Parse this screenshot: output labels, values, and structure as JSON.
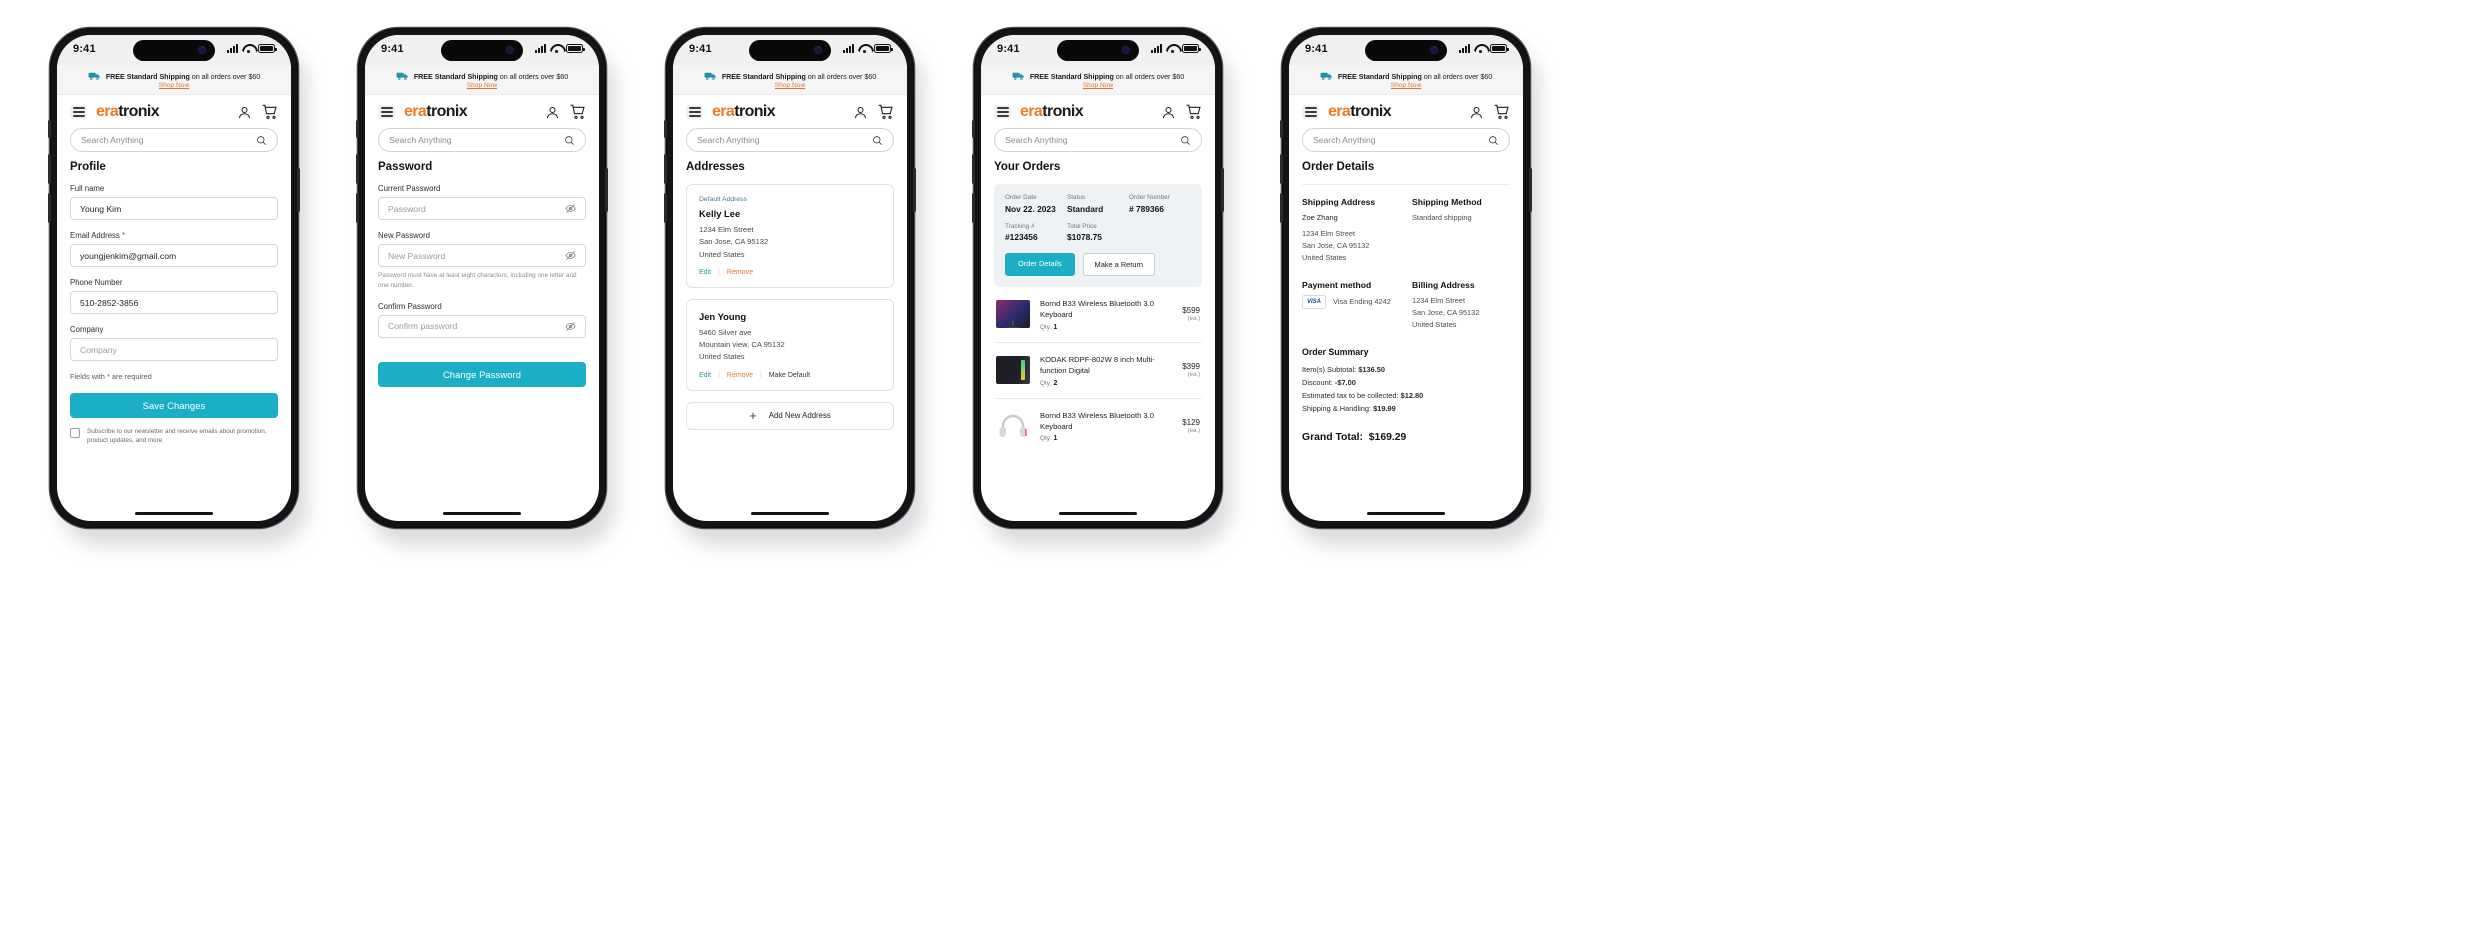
{
  "colors": {
    "accent": "#1aafc4",
    "brand_orange": "#f07c1f",
    "link_orange": "#e8742c",
    "required_red": "#d32a3a",
    "teal_link": "#2f93a8"
  },
  "status_bar": {
    "time": "9:41"
  },
  "promo": {
    "icon": "truck-icon",
    "bold_part": "FREE Standard Shipping",
    "rest_part": " on all orders over $60",
    "link": "Shop Now"
  },
  "nav": {
    "menu_icon": "hamburger-menu-icon",
    "brand_first": "era",
    "brand_second": "tronix",
    "account_icon": "user-account-icon",
    "cart_icon": "shopping-cart-icon"
  },
  "search": {
    "placeholder": "Search Anything",
    "icon": "search-icon"
  },
  "screens": [
    {
      "id": "profile",
      "title": "Profile",
      "fields": [
        {
          "label": "Full name",
          "required": false,
          "value": "Young Kim",
          "is_placeholder": false
        },
        {
          "label": "Email Address",
          "required": true,
          "value": "youngjenkim@gmail.com",
          "is_placeholder": false
        },
        {
          "label": "Phone Number",
          "required": false,
          "value": "510-2852-3856",
          "is_placeholder": false
        },
        {
          "label": "Company",
          "required": false,
          "value": "Company",
          "is_placeholder": true
        }
      ],
      "note_prefix": "Fields with ",
      "note_suffix": " are required",
      "submit": "Save Changes",
      "subscribe_text": "Subscribe to our newsletter and receive emails about promotion, product updates, and more"
    },
    {
      "id": "password",
      "title": "Password",
      "fields": [
        {
          "label": "Current Password",
          "value": "Password",
          "is_placeholder": true,
          "has_eye": true
        },
        {
          "label": "New Password",
          "value": "New Password",
          "is_placeholder": true,
          "has_eye": true
        },
        {
          "label": "Confirm Password",
          "value": "Confirm password",
          "is_placeholder": true,
          "has_eye": true
        }
      ],
      "hint": "Password must have at least eight characters, including one letter and one number.",
      "submit": "Change Password"
    },
    {
      "id": "addresses",
      "title": "Addresses",
      "cards": [
        {
          "tag": "Default Address",
          "name": "Kelly Lee",
          "lines": [
            "1234 Elm Street",
            "San Jose, CA 95132",
            "United States"
          ],
          "actions": [
            "Edit",
            "Remove"
          ]
        },
        {
          "tag": "",
          "name": "Jen Young",
          "lines": [
            "5460 Silver ave",
            "Mountain view, CA 95132",
            "United States"
          ],
          "actions": [
            "Edit",
            "Remove",
            "Make Default"
          ]
        }
      ],
      "add_new": "Add New Address",
      "add_icon": "plus-icon"
    },
    {
      "id": "orders",
      "title": "Your Orders",
      "summary": {
        "order_date_label": "Order Date",
        "order_date_value": "Nov 22. 2023",
        "status_label": "Status",
        "status_value": "Standard",
        "order_number_label": "Order Number",
        "order_number_value": "# 789366",
        "tracking_label": "Tracking #",
        "tracking_value": "#123456",
        "total_label": "Total Price",
        "total_value": "$1078.75",
        "primary_button": "Order Details",
        "secondary_button": "Make a Return"
      },
      "products": [
        {
          "name": "Bornd B33 Wireless Bluetooth 3.0 Keyboard",
          "qty_label": "Qty:",
          "qty": "1",
          "price": "$599",
          "unit": "(ea.)",
          "thumb": "monitor-thumbnail"
        },
        {
          "name": "KODAK RDPF-802W 8 inch Multi-function Digital",
          "qty_label": "Qty:",
          "qty": "2",
          "price": "$399",
          "unit": "(ea.)",
          "thumb": "pc-tower-thumbnail"
        },
        {
          "name": "Bornd B33 Wireless Bluetooth 3.0 Keyboard",
          "qty_label": "Qty:",
          "qty": "1",
          "price": "$129",
          "unit": "(ea.)",
          "thumb": "headset-thumbnail"
        }
      ]
    },
    {
      "id": "order-details",
      "title": "Order Details",
      "shipping_address": {
        "heading": "Shipping Address",
        "name": "Zoe Zhang",
        "lines": [
          "1234 Elm Street",
          "San Jose, CA 95132",
          "United States"
        ]
      },
      "shipping_method": {
        "heading": "Shipping Method",
        "value": "Standard shipping"
      },
      "payment_method": {
        "heading": "Payment method",
        "card_brand": "VISA",
        "card_text": "Visa Ending 4242"
      },
      "billing_address": {
        "heading": "Billing Address",
        "lines": [
          "1234 Elm Street",
          "San Jose, CA 95132",
          "United States"
        ]
      },
      "order_summary": {
        "heading": "Order Summary",
        "rows": [
          {
            "label": "Item(s) Subtotal:",
            "value": "$136.50"
          },
          {
            "label": "Discount:",
            "value": "-$7.00"
          },
          {
            "label": "Estimated tax to be collected:",
            "value": "$12.80"
          },
          {
            "label": "Shipping & Handling:",
            "value": "$19.99"
          }
        ],
        "grand_label": "Grand Total:",
        "grand_value": "$169.29"
      }
    }
  ]
}
